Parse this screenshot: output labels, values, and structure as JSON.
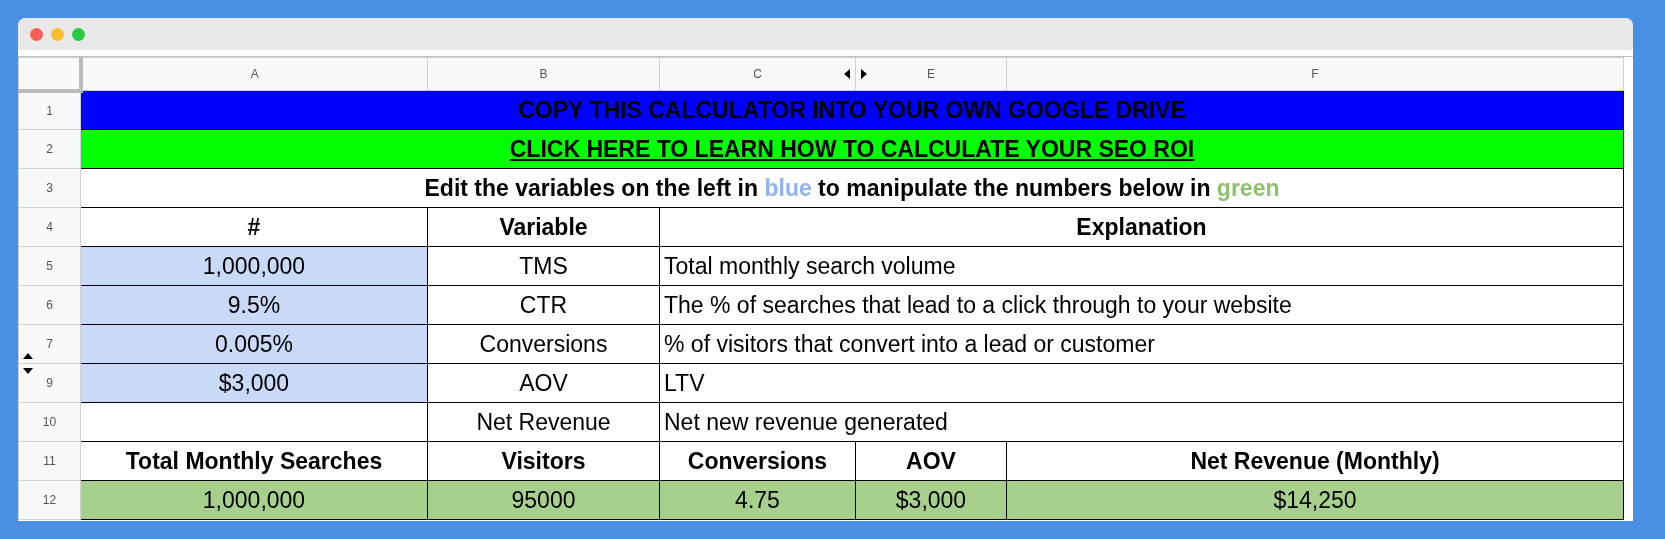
{
  "columns": [
    {
      "label": "A"
    },
    {
      "label": "B"
    },
    {
      "label": "C",
      "hidden_after": true
    },
    {
      "label": "E",
      "hidden_before": true
    },
    {
      "label": "F"
    }
  ],
  "rows": [
    {
      "number": "1",
      "cells": [
        {
          "kind": "banner",
          "text": "COPY THIS CALCULATOR INTO YOUR OWN GOOGLE DRIVE",
          "color": "#0000ff"
        }
      ]
    },
    {
      "number": "2",
      "cells": [
        {
          "kind": "link",
          "text": "CLICK HERE TO LEARN HOW TO CALCULATE YOUR SEO ROI",
          "color": "#00ff00"
        }
      ]
    },
    {
      "number": "3",
      "cells": [
        {
          "kind": "heading",
          "parts": [
            {
              "text": "Edit the variables on the left in "
            },
            {
              "text": "blue",
              "color": "#8fb3ee"
            },
            {
              "text": " to manipulate the numbers below in "
            },
            {
              "text": "green",
              "color": "#8cc26f"
            }
          ]
        }
      ]
    },
    {
      "number": "4",
      "cells": [
        {
          "kind": "heading",
          "text": "#"
        },
        {
          "kind": "heading",
          "text": "Variable"
        },
        {
          "kind": "heading",
          "text": "Explanation"
        }
      ]
    },
    {
      "number": "5",
      "cells": [
        {
          "kind": "value",
          "text": "1,000,000",
          "color": "#c9daf8"
        },
        {
          "kind": "value",
          "text": "TMS"
        },
        {
          "kind": "explanation",
          "text": "Total monthly search volume"
        }
      ]
    },
    {
      "number": "6",
      "cells": [
        {
          "kind": "value",
          "text": "9.5%",
          "color": "#c9daf8"
        },
        {
          "kind": "value",
          "text": "CTR"
        },
        {
          "kind": "explanation",
          "text": "The % of searches that lead to a click through to your website"
        }
      ]
    },
    {
      "number": "7",
      "hidden_after": true,
      "cells": [
        {
          "kind": "value",
          "text": "0.005%",
          "color": "#c9daf8"
        },
        {
          "kind": "value",
          "text": "Conversions"
        },
        {
          "kind": "explanation",
          "text": "% of visitors that convert into a lead or customer"
        }
      ]
    },
    {
      "number": "9",
      "hidden_before": true,
      "cells": [
        {
          "kind": "value",
          "text": "$3,000",
          "color": "#c9daf8"
        },
        {
          "kind": "value",
          "text": "AOV"
        },
        {
          "kind": "explanation",
          "text": "LTV"
        }
      ]
    },
    {
      "number": "10",
      "cells": [
        {
          "kind": "value"
        },
        {
          "kind": "value",
          "text": "Net Revenue"
        },
        {
          "kind": "explanation",
          "text": "Net new revenue generated"
        }
      ]
    },
    {
      "number": "11",
      "cells": [
        {
          "kind": "heading",
          "text": "Total Monthly Searches"
        },
        {
          "kind": "heading",
          "text": "Visitors"
        },
        {
          "kind": "heading",
          "text": "Conversions"
        },
        {
          "kind": "heading",
          "text": "AOV"
        },
        {
          "kind": "heading",
          "text": "Net Revenue (Monthly)"
        }
      ]
    },
    {
      "number": "12",
      "cells": [
        {
          "kind": "value",
          "text": "1,000,000",
          "color": "#a8d08d"
        },
        {
          "kind": "value",
          "text": "95000",
          "color": "#a8d08d"
        },
        {
          "kind": "value",
          "text": "4.75",
          "color": "#a8d08d"
        },
        {
          "kind": "value",
          "text": "$3,000",
          "color": "#a8d08d"
        },
        {
          "kind": "value",
          "text": "$14,250",
          "color": "#a8d08d"
        }
      ]
    }
  ]
}
